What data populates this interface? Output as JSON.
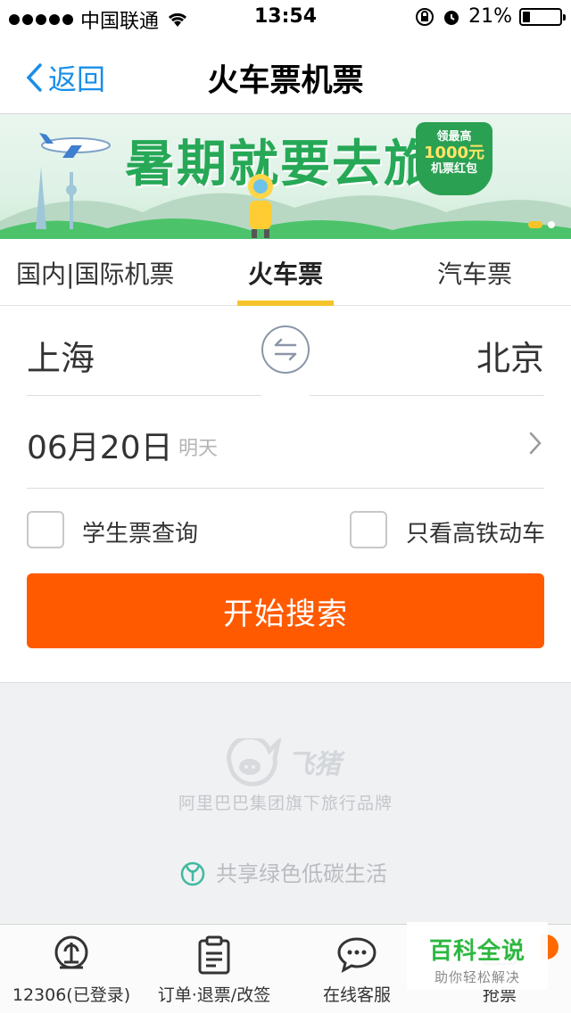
{
  "status_bar": {
    "carrier": "中国联通",
    "time": "13:54",
    "battery_percent": "21%",
    "battery_level": 0.21
  },
  "nav": {
    "back_label": "返回",
    "title": "火车票机票"
  },
  "banner": {
    "title": "暑期就要去旅行",
    "tag_line1": "领最高",
    "tag_line2": "1000元",
    "tag_line3": "机票红包"
  },
  "tabs": [
    {
      "label": "国内|国际机票"
    },
    {
      "label": "火车票"
    },
    {
      "label": "汽车票"
    }
  ],
  "form": {
    "from_city": "上海",
    "to_city": "北京",
    "date": "06月20日",
    "date_hint": "明天",
    "student_label": "学生票查询",
    "highspeed_label": "只看高铁动车",
    "search_label": "开始搜索"
  },
  "brand": {
    "name": "飞猪",
    "subtitle": "阿里巴巴集团旗下旅行品牌",
    "green_slogan": "共享绿色低碳生活"
  },
  "tabbar": [
    {
      "label": "12306(已登录)",
      "icon": "train-icon"
    },
    {
      "label": "订单·退票/改签",
      "icon": "clipboard-icon"
    },
    {
      "label": "在线客服",
      "icon": "chat-icon"
    },
    {
      "label": "抢票",
      "icon": "ticket-icon"
    }
  ],
  "watermark": {
    "title": "百科全说",
    "subtitle": "助你轻松解决"
  },
  "colors": {
    "accent_blue": "#1a8ee8",
    "search_orange": "#ff5a00",
    "tab_indicator": "#f5c42a",
    "banner_green": "#26a856"
  }
}
